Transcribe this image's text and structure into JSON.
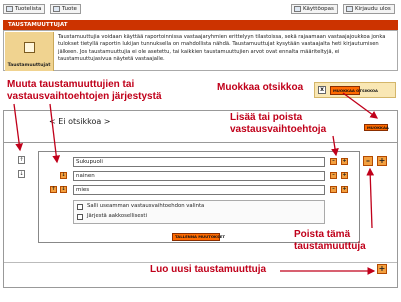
{
  "toolbar": {
    "back_label": "Tuotelista",
    "product_label": "Tuote",
    "help_label": "Käyttöopas",
    "logout_label": "Kirjaudu ulos"
  },
  "banner": {
    "title": "TAUSTAMUUTTUJAT"
  },
  "description": {
    "icon_label": "Taustamuuttujat",
    "text": "Taustamuuttujia voidaan käyttää raportoinnissa vastaajaryhmien erittelyyn tilastoissa, sekä rajaamaan vastaajajoukkoa jonka tulokset tietyllä raportin lukijan tunnuksella on mahdollista nähdä. Taustamuuttujat kysytään vastaajalta heti kirjautumisen jälkeen. Jos taustamuuttujia ei ole asetettu, tai kaikkien taustamuuttujien arvot ovat ennalta määriteltyjä, ei taustamuuttujasivua näytetä vastaajalle."
  },
  "editor": {
    "otsikko_text": "< Ei otsikkoa >",
    "title_button": "MUOKKAA OTSIKKOA",
    "edit_button": "MUOKKAA",
    "variable_name": "Sukupuoli",
    "options": [
      "nainen",
      "mies"
    ],
    "checkbox_multi": "Salli useamman vastausvaihtoehdon valinta",
    "checkbox_sort": "Järjestä aakkosellisesti",
    "save_button": "TALLENNA MUUTOKSET",
    "move_up_symbol": "↑",
    "move_down_symbol": "↓",
    "add_symbol": "+",
    "remove_symbol": "–",
    "close_symbol": "x"
  },
  "annotations": {
    "reorder": "Muuta taustamuuttujien tai vastausvaihtoehtojen järjestystä",
    "edit_title": "Muokkaa otsikkoa",
    "add_remove_options": "Lisää tai poista vastausvaihtoehtoja",
    "remove_variable": "Poista tämä taustamuuttuja",
    "create_new": "Luo uusi taustamuuttuja"
  },
  "colors": {
    "banner": "#cc3300",
    "annotation": "#c0001a",
    "button_orange": "#f3a040",
    "chip_orange": "#ff6a00"
  }
}
